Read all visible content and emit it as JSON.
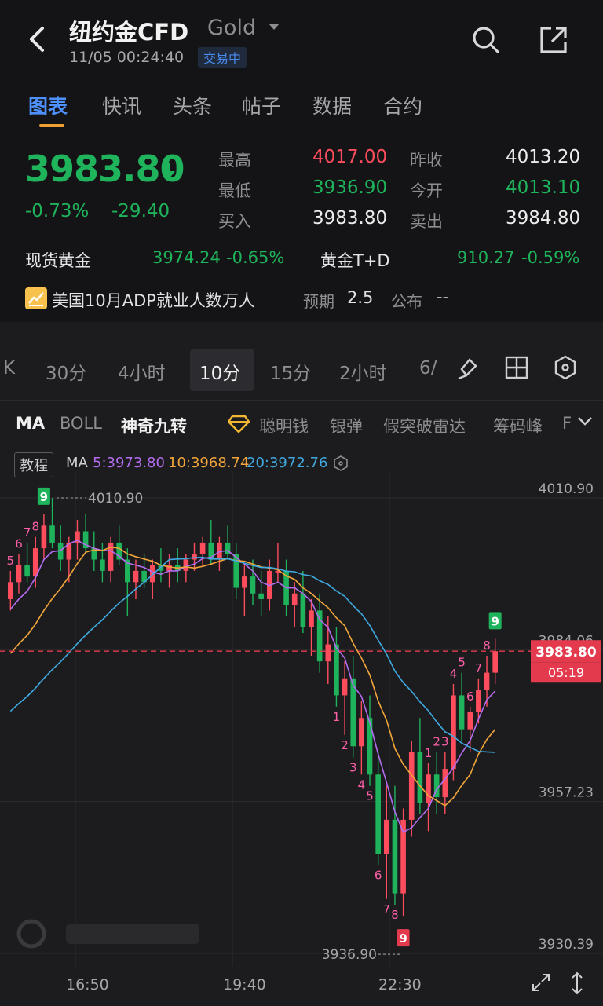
{
  "header": {
    "title": "纽约金CFD",
    "subtitle": "Gold",
    "time": "11/05 00:24:40",
    "status": "交易中"
  },
  "tabs": [
    {
      "label": "图表",
      "active": true
    },
    {
      "label": "快讯"
    },
    {
      "label": "头条"
    },
    {
      "label": "帖子"
    },
    {
      "label": "数据"
    },
    {
      "label": "合约"
    }
  ],
  "quote": {
    "price": "3983.80",
    "change_pct": "-0.73%",
    "change_abs": "-29.40",
    "high_label": "最高",
    "high": "4017.00",
    "low_label": "最低",
    "low": "3936.90",
    "bid_label": "买入",
    "bid": "3983.80",
    "prev_close_label": "昨收",
    "prev_close": "4013.20",
    "open_label": "今开",
    "open": "4013.10",
    "ask_label": "卖出",
    "ask": "3984.80",
    "spot_name": "现货黄金",
    "spot_price": "3974.24",
    "spot_pct": "-0.65%",
    "td_name": "黄金T+D",
    "td_price": "910.27",
    "td_pct": "-0.59%",
    "event": "美国10月ADP就业人数万人",
    "expected_label": "预期",
    "expected": "2.5",
    "published_label": "公布",
    "published": "--"
  },
  "periods": [
    {
      "label": "K"
    },
    {
      "label": "30分"
    },
    {
      "label": "4小时"
    },
    {
      "label": "10分",
      "active": true
    },
    {
      "label": "15分"
    },
    {
      "label": "2小时"
    },
    {
      "label": "6/"
    }
  ],
  "indicators": {
    "ma": "MA",
    "boll": "BOLL",
    "magic9": "神奇九转",
    "smart": "聪明钱",
    "silver": "银弹",
    "fakebreak": "假突破雷达",
    "chips": "筹码峰",
    "more": "F"
  },
  "legend": {
    "tutorial": "教程",
    "ma_label": "MA",
    "ma5": "5:3973.80",
    "ma10": "10:3968.74",
    "ma20": "20:3972.76"
  },
  "colors": {
    "up": "#ff4d5e",
    "down": "#1fb35b",
    "ma5": "#b46cf0",
    "ma10": "#f2a63a",
    "ma20": "#3fa9e0",
    "magic": "#ff5fa8"
  },
  "chart_data": {
    "type": "candlestick",
    "y_ticks": [
      "4010.90",
      "3984.06",
      "3957.23",
      "3930.39"
    ],
    "ylim": [
      3930.39,
      4010.9
    ],
    "x_ticks": [
      "16:50",
      "19:40",
      "22:30"
    ],
    "high_marker": "4010.90",
    "low_marker": "3936.90",
    "last_price": "3983.80",
    "countdown": "05:19",
    "candles": [
      [
        3993,
        3998,
        3991,
        3996
      ],
      [
        3996,
        4001,
        3994,
        3999
      ],
      [
        3999,
        4003,
        3996,
        3997
      ],
      [
        3997,
        4004,
        3995,
        4002
      ],
      [
        4002,
        4008,
        4000,
        4006
      ],
      [
        4006,
        4010.9,
        4002,
        4003
      ],
      [
        4003,
        4006,
        3998,
        4000
      ],
      [
        4000,
        4004,
        3996,
        4003
      ],
      [
        4003,
        4007,
        4000,
        4005
      ],
      [
        4005,
        4008,
        4001,
        4002
      ],
      [
        4002,
        4005,
        3998,
        4000
      ],
      [
        4000,
        4003,
        3996,
        3998
      ],
      [
        3998,
        4004,
        3996,
        4003
      ],
      [
        4003,
        4006,
        3999,
        4000
      ],
      [
        4000,
        4002,
        3990,
        3996
      ],
      [
        3996,
        4000,
        3993,
        3998
      ],
      [
        3998,
        4001,
        3995,
        3996
      ],
      [
        3996,
        4000,
        3993,
        3999
      ],
      [
        3999,
        4002,
        3996,
        3998
      ],
      [
        3998,
        4001,
        3995,
        3999
      ],
      [
        3999,
        4002,
        3996,
        3998
      ],
      [
        3998,
        4001,
        3996,
        4000
      ],
      [
        4000,
        4003,
        3998,
        4001
      ],
      [
        4001,
        4004,
        3999,
        4003
      ],
      [
        4003,
        4007,
        3999,
        4000
      ],
      [
        4000,
        4004,
        3998,
        4003
      ],
      [
        4003,
        4006,
        4000,
        4001
      ],
      [
        4001,
        4003,
        3993,
        3995
      ],
      [
        3995,
        3999,
        3990,
        3997
      ],
      [
        3997,
        4000,
        3992,
        3994
      ],
      [
        3994,
        3998,
        3990,
        3993
      ],
      [
        3993,
        4000,
        3991,
        3998
      ],
      [
        3998,
        4003,
        3996,
        3998
      ],
      [
        3998,
        4000,
        3990,
        3992
      ],
      [
        3992,
        3996,
        3988,
        3994
      ],
      [
        3994,
        3998,
        3987,
        3988
      ],
      [
        3988,
        3993,
        3983,
        3991
      ],
      [
        3991,
        3994,
        3980,
        3982
      ],
      [
        3982,
        3990,
        3978,
        3985
      ],
      [
        3985,
        3988,
        3974,
        3976
      ],
      [
        3976,
        3982,
        3969,
        3979
      ],
      [
        3979,
        3983,
        3965,
        3967
      ],
      [
        3967,
        3975,
        3962,
        3972
      ],
      [
        3972,
        3976,
        3960,
        3962
      ],
      [
        3962,
        3966,
        3946,
        3948
      ],
      [
        3948,
        3960,
        3940,
        3954
      ],
      [
        3954,
        3960,
        3939,
        3941
      ],
      [
        3941,
        3956,
        3936.9,
        3954
      ],
      [
        3954,
        3968,
        3951,
        3966
      ],
      [
        3966,
        3972,
        3955,
        3957
      ],
      [
        3957,
        3964,
        3952,
        3962
      ],
      [
        3962,
        3966,
        3955,
        3958
      ],
      [
        3958,
        3966,
        3955,
        3963
      ],
      [
        3963,
        3978,
        3961,
        3976
      ],
      [
        3976,
        3980,
        3968,
        3970
      ],
      [
        3970,
        3974,
        3966,
        3973
      ],
      [
        3973,
        3979,
        3971,
        3977
      ],
      [
        3977,
        3983,
        3974,
        3980
      ],
      [
        3980,
        3986,
        3978,
        3983.8
      ]
    ],
    "magic_counts": [
      {
        "i": 0,
        "n": "5"
      },
      {
        "i": 1,
        "n": "6"
      },
      {
        "i": 2,
        "n": "7"
      },
      {
        "i": 3,
        "n": "8"
      },
      {
        "i": 4,
        "n": "9",
        "boxed": true
      },
      {
        "i": 39,
        "n": "1"
      },
      {
        "i": 40,
        "n": "2"
      },
      {
        "i": 41,
        "n": "3"
      },
      {
        "i": 42,
        "n": "4"
      },
      {
        "i": 43,
        "n": "5"
      },
      {
        "i": 44,
        "n": "6"
      },
      {
        "i": 45,
        "n": "7"
      },
      {
        "i": 46,
        "n": "8"
      },
      {
        "i": 47,
        "n": "9",
        "boxed": true,
        "below": true
      },
      {
        "i": 50,
        "n": "1"
      },
      {
        "i": 51,
        "n": "2"
      },
      {
        "i": 52,
        "n": "3"
      },
      {
        "i": 53,
        "n": "4"
      },
      {
        "i": 54,
        "n": "5"
      },
      {
        "i": 55,
        "n": "6"
      },
      {
        "i": 56,
        "n": "7"
      },
      {
        "i": 57,
        "n": "8"
      },
      {
        "i": 58,
        "n": "9",
        "boxed": true
      }
    ]
  }
}
